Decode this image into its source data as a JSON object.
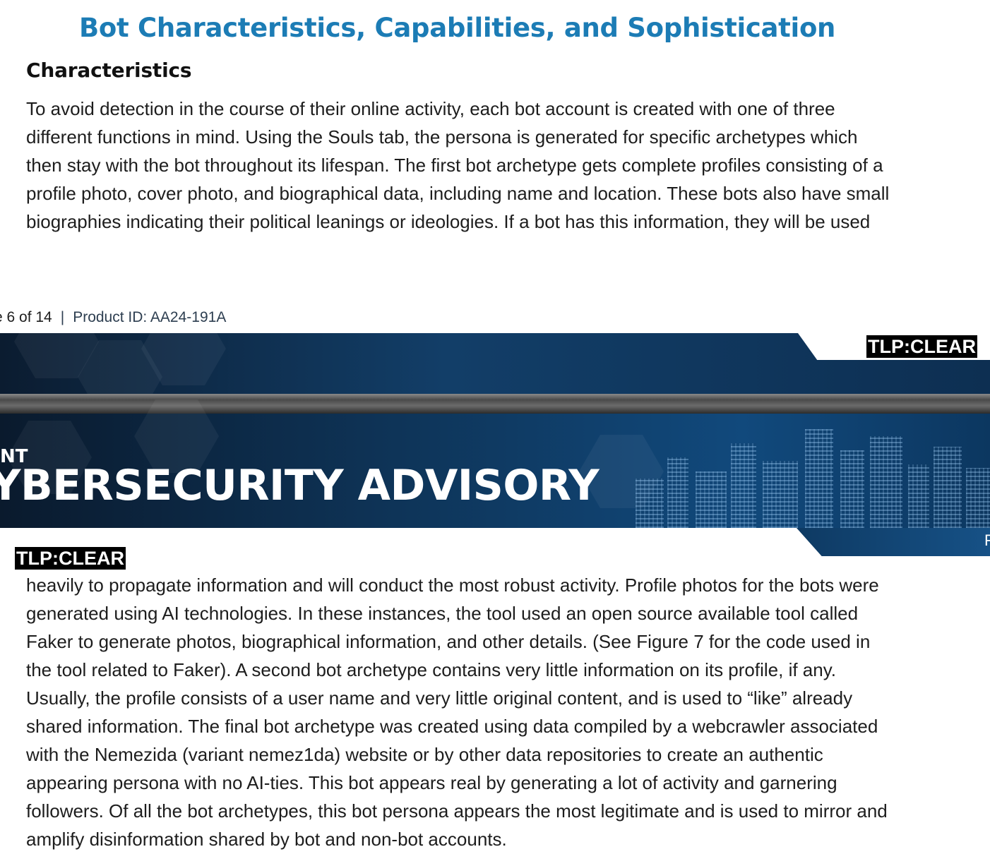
{
  "section": {
    "title": "Bot Characteristics, Capabilities, and Sophistication",
    "subtitle": "Characteristics"
  },
  "paragraph_top": {
    "lines": [
      "To avoid detection in the course of their online activity, each bot account is created with one of three",
      "different functions in mind. Using the Souls tab, the persona is generated for specific archetypes which",
      "then stay with the bot throughout its lifespan. The first bot archetype gets complete profiles consisting of a",
      "profile photo, cover photo, and biographical data, including name and location. These bots also have small",
      "biographies indicating their political leanings or ideologies. If a bot has this information, they will be used"
    ]
  },
  "footer": {
    "page_prefix": "e 6 of 14",
    "separator": "|",
    "product_id": "Product ID: AA24-191A"
  },
  "banner": {
    "tlp_top": "TLP:CLEAR",
    "kicker": "NT",
    "title": "YBERSECURITY ADVISORY",
    "tab_letter": "F",
    "tlp_bottom": "TLP:CLEAR"
  },
  "paragraph_bottom": {
    "lines": [
      "heavily to propagate information and will conduct the most robust activity. Profile photos for the bots were",
      "generated using AI technologies. In these instances, the tool used an open source available tool called",
      "Faker to generate photos, biographical information, and other details. (See Figure 7 for the code used in",
      "the tool related to Faker). A second bot archetype contains very little information on its profile, if any.",
      "Usually, the profile consists of a user name and very little original content, and is used to “like” already",
      "shared information. The final bot archetype was created using data compiled by a webcrawler associated",
      "with the Nemezida (variant nemez1da) website or by other data repositories to create an authentic",
      "appearing persona with no AI-ties. This bot appears real by generating a lot of activity and garnering",
      "followers. Of all the bot archetypes, this bot persona appears the most legitimate and is used to mirror and",
      "amplify disinformation shared by bot and non-bot accounts."
    ]
  },
  "colors": {
    "heading_blue": "#1c7cb5",
    "banner_navy": "#0e3458",
    "tlp_background": "#000000"
  }
}
